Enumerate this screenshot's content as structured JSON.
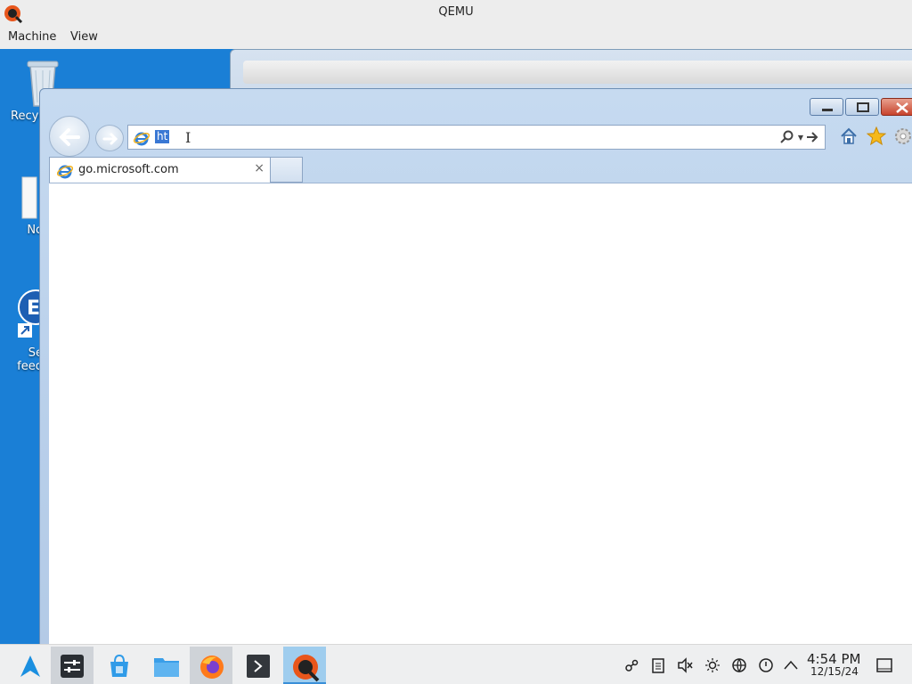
{
  "qemu": {
    "title": "QEMU",
    "menu": [
      "Machine",
      "View"
    ]
  },
  "desktop": {
    "icons": [
      {
        "name": "recycle-bin",
        "label": "Recyc"
      },
      {
        "name": "notepad",
        "label": "No"
      },
      {
        "name": "edge-feedback",
        "label_line1": "Se",
        "label_line2": "feed"
      }
    ]
  },
  "browser": {
    "address_value": "ht",
    "tab_title": "go.microsoft.com",
    "tab_close": "×",
    "buttons": {
      "minimize": "—",
      "maximize": "▢",
      "close": "✕"
    }
  },
  "taskbar": {
    "apps": [
      "app-launcher",
      "system-settings",
      "software-store",
      "file-manager",
      "firefox",
      "terminal",
      "qemu"
    ],
    "clock_time": "4:54 PM",
    "clock_date": "12/15/24"
  },
  "colors": {
    "desktop": "#1a7fd6",
    "ie_frame": "#b8cfea",
    "close_button": "#c7432d",
    "taskbar": "#eeeff0",
    "selection": "#3a78d4"
  }
}
